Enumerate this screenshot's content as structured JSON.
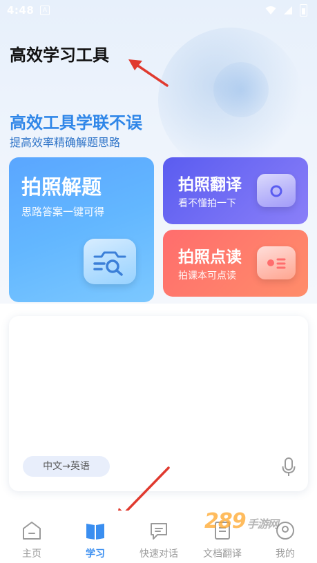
{
  "status": {
    "time": "4:48",
    "badge": "A"
  },
  "header": {
    "title": "高效学习工具"
  },
  "banner": {
    "slogan": "高效工具学联不误",
    "subtitle": "提高效率精确解题思路"
  },
  "cards": {
    "solve": {
      "title": "拍照解题",
      "subtitle": "思路答案一键可得"
    },
    "translate": {
      "title": "拍照翻译",
      "subtitle": "看不懂拍一下"
    },
    "read": {
      "title": "拍照点读",
      "subtitle": "拍课本可点读"
    }
  },
  "input_panel": {
    "language_pair": "中文→英语"
  },
  "tabs": [
    {
      "label": "主页",
      "icon": "home-icon"
    },
    {
      "label": "学习",
      "icon": "book-icon"
    },
    {
      "label": "快速对话",
      "icon": "chat-icon"
    },
    {
      "label": "文档翻译",
      "icon": "document-icon"
    },
    {
      "label": "我的",
      "icon": "profile-icon"
    }
  ],
  "active_tab": "学习",
  "watermark": {
    "text": "289",
    "suffix": "手游网"
  },
  "colors": {
    "accent": "#3a8ef0",
    "slogan": "#2f86e8",
    "annotation_arrow": "#e03a2f"
  }
}
